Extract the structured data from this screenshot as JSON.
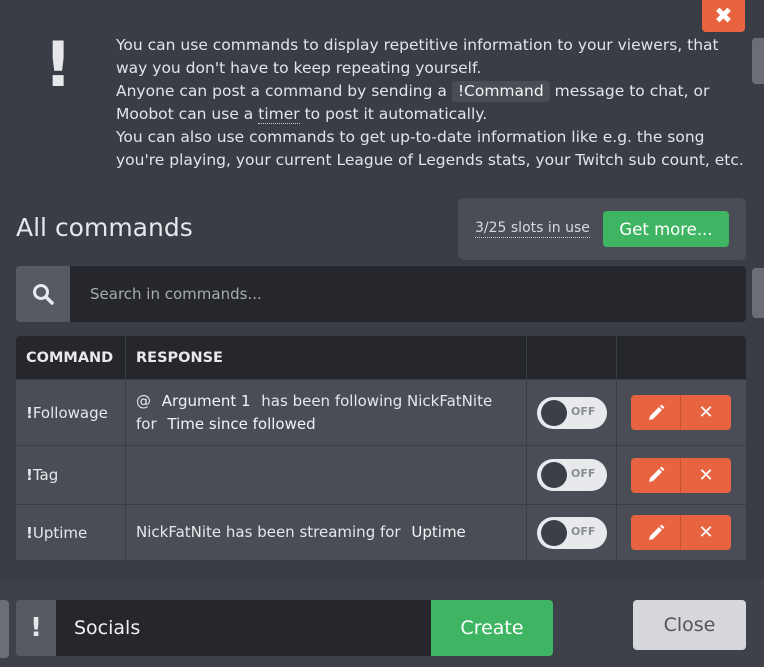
{
  "close_x_glyph": "✖",
  "info": {
    "line1": "You can use commands to display repetitive information to your viewers, that way you don't have to keep repeating yourself.",
    "line2_pre": "Anyone can post a command by sending a",
    "command_chip": "!Command",
    "line2_post": "message to chat, or Moobot can use a",
    "timer_word": "timer",
    "line2_end": "to post it automatically.",
    "line3": "You can also use commands to get up-to-date information like e.g. the song you're playing, your current League of Legends stats, your Twitch sub count, etc."
  },
  "heading": "All commands",
  "slots": {
    "text": "3/25 slots in use",
    "button": "Get more..."
  },
  "search": {
    "placeholder": "Search in commands..."
  },
  "table": {
    "headers": [
      "COMMAND",
      "RESPONSE",
      "",
      ""
    ],
    "rows": [
      {
        "bang": "!",
        "command": "Followage",
        "resp_prefix": "@",
        "chip1": "Argument 1",
        "resp_mid": "has been following NickFatNite for",
        "chip2": "Time since followed",
        "toggle": "OFF"
      },
      {
        "bang": "!",
        "command": "Tag",
        "toggle": "OFF"
      },
      {
        "bang": "!",
        "command": "Uptime",
        "resp_text": "NickFatNite has been streaming for",
        "chip1": "Uptime",
        "toggle": "OFF"
      }
    ]
  },
  "create": {
    "bang": "!",
    "value": "Socials",
    "button": "Create"
  },
  "close_button": "Close",
  "colors": {
    "accent_orange": "#e8633f",
    "accent_green": "#3fb563",
    "bg": "#3a3d45"
  }
}
